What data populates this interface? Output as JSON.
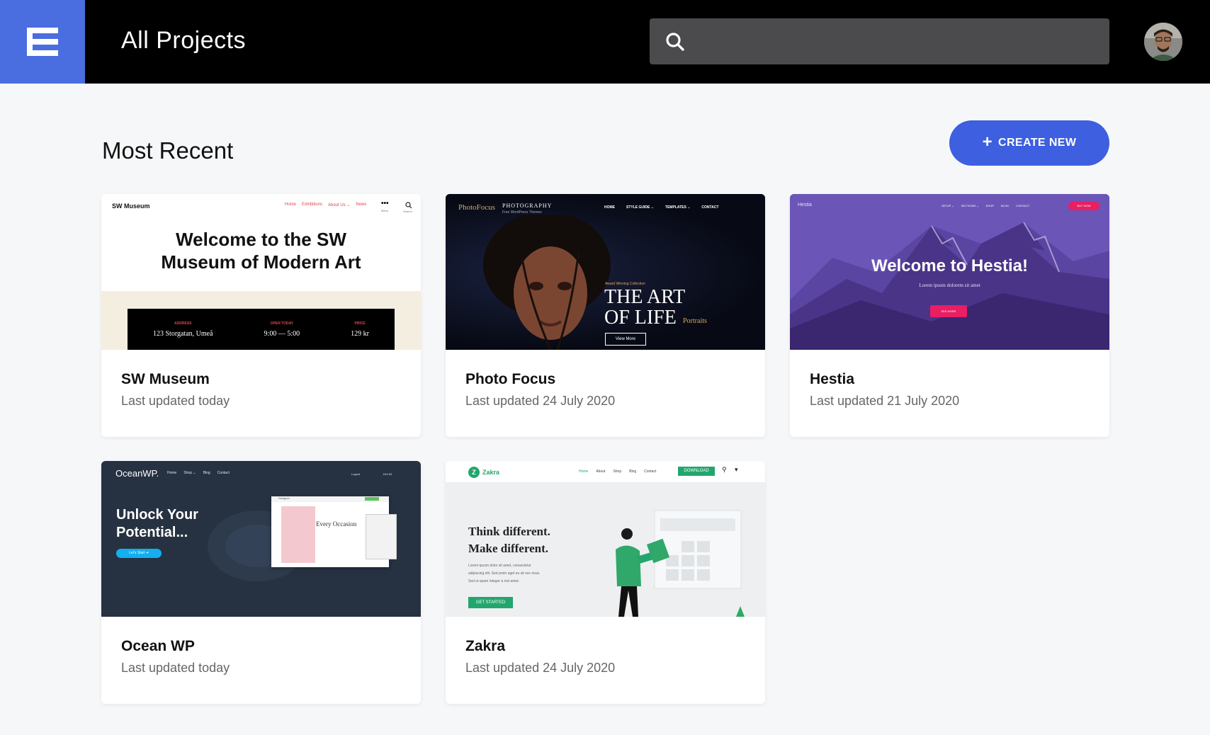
{
  "header": {
    "title": "All Projects",
    "search_placeholder": "",
    "brand_color": "#4a6ee0"
  },
  "main": {
    "section_title": "Most Recent",
    "create_label": "CREATE NEW",
    "accent_color": "#3d5fe0"
  },
  "projects": [
    {
      "name": "SW Museum",
      "updated": "Last updated today",
      "thumb": {
        "site": "SW Museum",
        "nav": [
          "Home",
          "Exhibitions",
          "About Us ⌄",
          "News"
        ],
        "menu": "Menu",
        "search": "Search",
        "headline_1": "Welcome to the SW",
        "headline_2": "Museum of Modern Art",
        "info": [
          {
            "label": "ADDRESS",
            "value": "123 Storgatan, Umeå"
          },
          {
            "label": "OPEN TODAY",
            "value": "9:00 — 5:00"
          },
          {
            "label": "PRICE",
            "value": "129 kr"
          }
        ]
      }
    },
    {
      "name": "Photo Focus",
      "updated": "Last updated 24 July 2020",
      "thumb": {
        "logo": "PhotoFocus",
        "tag": "PHOTOGRAPHY",
        "sub": "Free WordPress Themes",
        "nav": [
          "HOME",
          "STYLE GUIDE ⌄",
          "TEMPLATES ⌄",
          "CONTACT"
        ],
        "award": "Award Winning Collection",
        "headline_1": "THE ART",
        "headline_2": "OF LIFE",
        "portraits": "Portraits",
        "button": "View More"
      }
    },
    {
      "name": "Hestia",
      "updated": "Last updated 21 July 2020",
      "thumb": {
        "logo": "Hestia",
        "nav": [
          "SETUP ⌄",
          "SECTIONS ⌄",
          "SHOP",
          "BLOG",
          "CONTACT"
        ],
        "buy": "BUY NOW",
        "headline": "Welcome to Hestia!",
        "sub": "Lorem ipsum dolorem sit amet",
        "button": "SEE MORE"
      }
    },
    {
      "name": "Ocean WP",
      "updated": "Last updated today",
      "thumb": {
        "logo": "OceanWP.",
        "nav": [
          "Home",
          "Shop ⌄",
          "Blog",
          "Contact"
        ],
        "login": "Logout",
        "cart": "£44.00",
        "headline_1": "Unlock Your",
        "headline_2": "Potential...",
        "button": "Let's Start ➜",
        "inner_label": "Designer",
        "inner_title": "Every Occasion"
      }
    },
    {
      "name": "Zakra",
      "updated": "Last updated 24 July 2020",
      "thumb": {
        "logo": "Zakra",
        "nav": [
          "Home",
          "About",
          "Shop",
          "Blog",
          "Contact"
        ],
        "download": "DOWNLOAD",
        "headline_1": "Think different.",
        "headline_2": "Make different.",
        "body_1": "Lorem ipsum dolor sit amet, consectetur",
        "body_2": "adipiscing elit. Sed proin eget eu sit nec risus.",
        "body_3": "Sed ut quam integer a nisl amet.",
        "button": "GET STARTED"
      }
    }
  ]
}
